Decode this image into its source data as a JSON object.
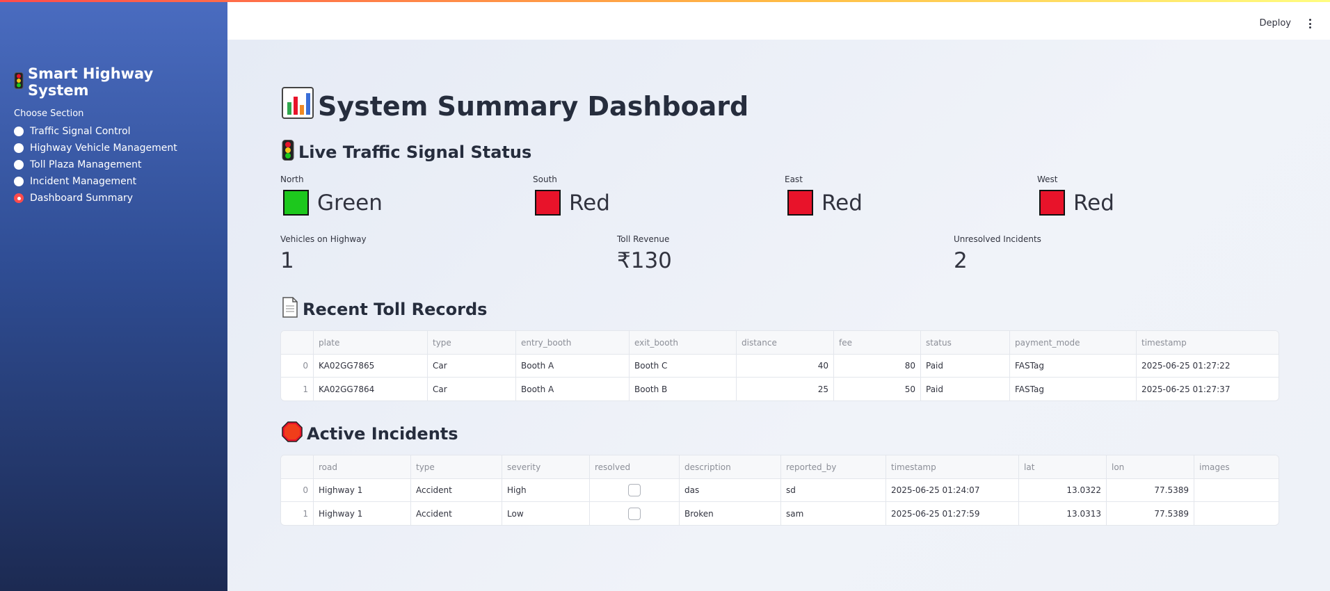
{
  "sidebar": {
    "title": "Smart Highway System",
    "section_label": "Choose Section",
    "items": [
      {
        "label": "Traffic Signal Control",
        "selected": false
      },
      {
        "label": "Highway Vehicle Management",
        "selected": false
      },
      {
        "label": "Toll Plaza Management",
        "selected": false
      },
      {
        "label": "Incident Management",
        "selected": false
      },
      {
        "label": "Dashboard Summary",
        "selected": true
      }
    ]
  },
  "header": {
    "deploy_label": "Deploy"
  },
  "page": {
    "title": "System Summary Dashboard"
  },
  "signals": {
    "heading": "Live Traffic Signal Status",
    "items": [
      {
        "direction": "North",
        "status": "Green",
        "color": "#1dc81d"
      },
      {
        "direction": "South",
        "status": "Red",
        "color": "#e8132a"
      },
      {
        "direction": "East",
        "status": "Red",
        "color": "#e8132a"
      },
      {
        "direction": "West",
        "status": "Red",
        "color": "#e8132a"
      }
    ]
  },
  "metrics": [
    {
      "label": "Vehicles on Highway",
      "value": "1"
    },
    {
      "label": "Toll Revenue",
      "value": "₹130"
    },
    {
      "label": "Unresolved Incidents",
      "value": "2"
    }
  ],
  "toll": {
    "heading": "Recent Toll Records",
    "columns": [
      "",
      "plate",
      "type",
      "entry_booth",
      "exit_booth",
      "distance",
      "fee",
      "status",
      "payment_mode",
      "timestamp"
    ],
    "rows": [
      [
        "0",
        "KA02GG7865",
        "Car",
        "Booth A",
        "Booth C",
        "40",
        "80",
        "Paid",
        "FASTag",
        "2025-06-25 01:27:22"
      ],
      [
        "1",
        "KA02GG7864",
        "Car",
        "Booth A",
        "Booth B",
        "25",
        "50",
        "Paid",
        "FASTag",
        "2025-06-25 01:27:37"
      ]
    ]
  },
  "incidents": {
    "heading": "Active Incidents",
    "columns": [
      "",
      "road",
      "type",
      "severity",
      "resolved",
      "description",
      "reported_by",
      "timestamp",
      "lat",
      "lon",
      "images"
    ],
    "rows": [
      [
        "0",
        "Highway 1",
        "Accident",
        "High",
        "",
        "das",
        "sd",
        "2025-06-25 01:24:07",
        "13.0322",
        "77.5389",
        ""
      ],
      [
        "1",
        "Highway 1",
        "Accident",
        "Low",
        "",
        "Broken",
        "sam",
        "2025-06-25 01:27:59",
        "13.0313",
        "77.5389",
        ""
      ]
    ],
    "resolved_values": [
      false,
      false
    ]
  },
  "colors": {
    "accent": "#ff4b4b",
    "sidebar_top": "#4a6cc0",
    "sidebar_bottom": "#1c2a52",
    "signal_green": "#1dc81d",
    "signal_red": "#e8132a"
  }
}
